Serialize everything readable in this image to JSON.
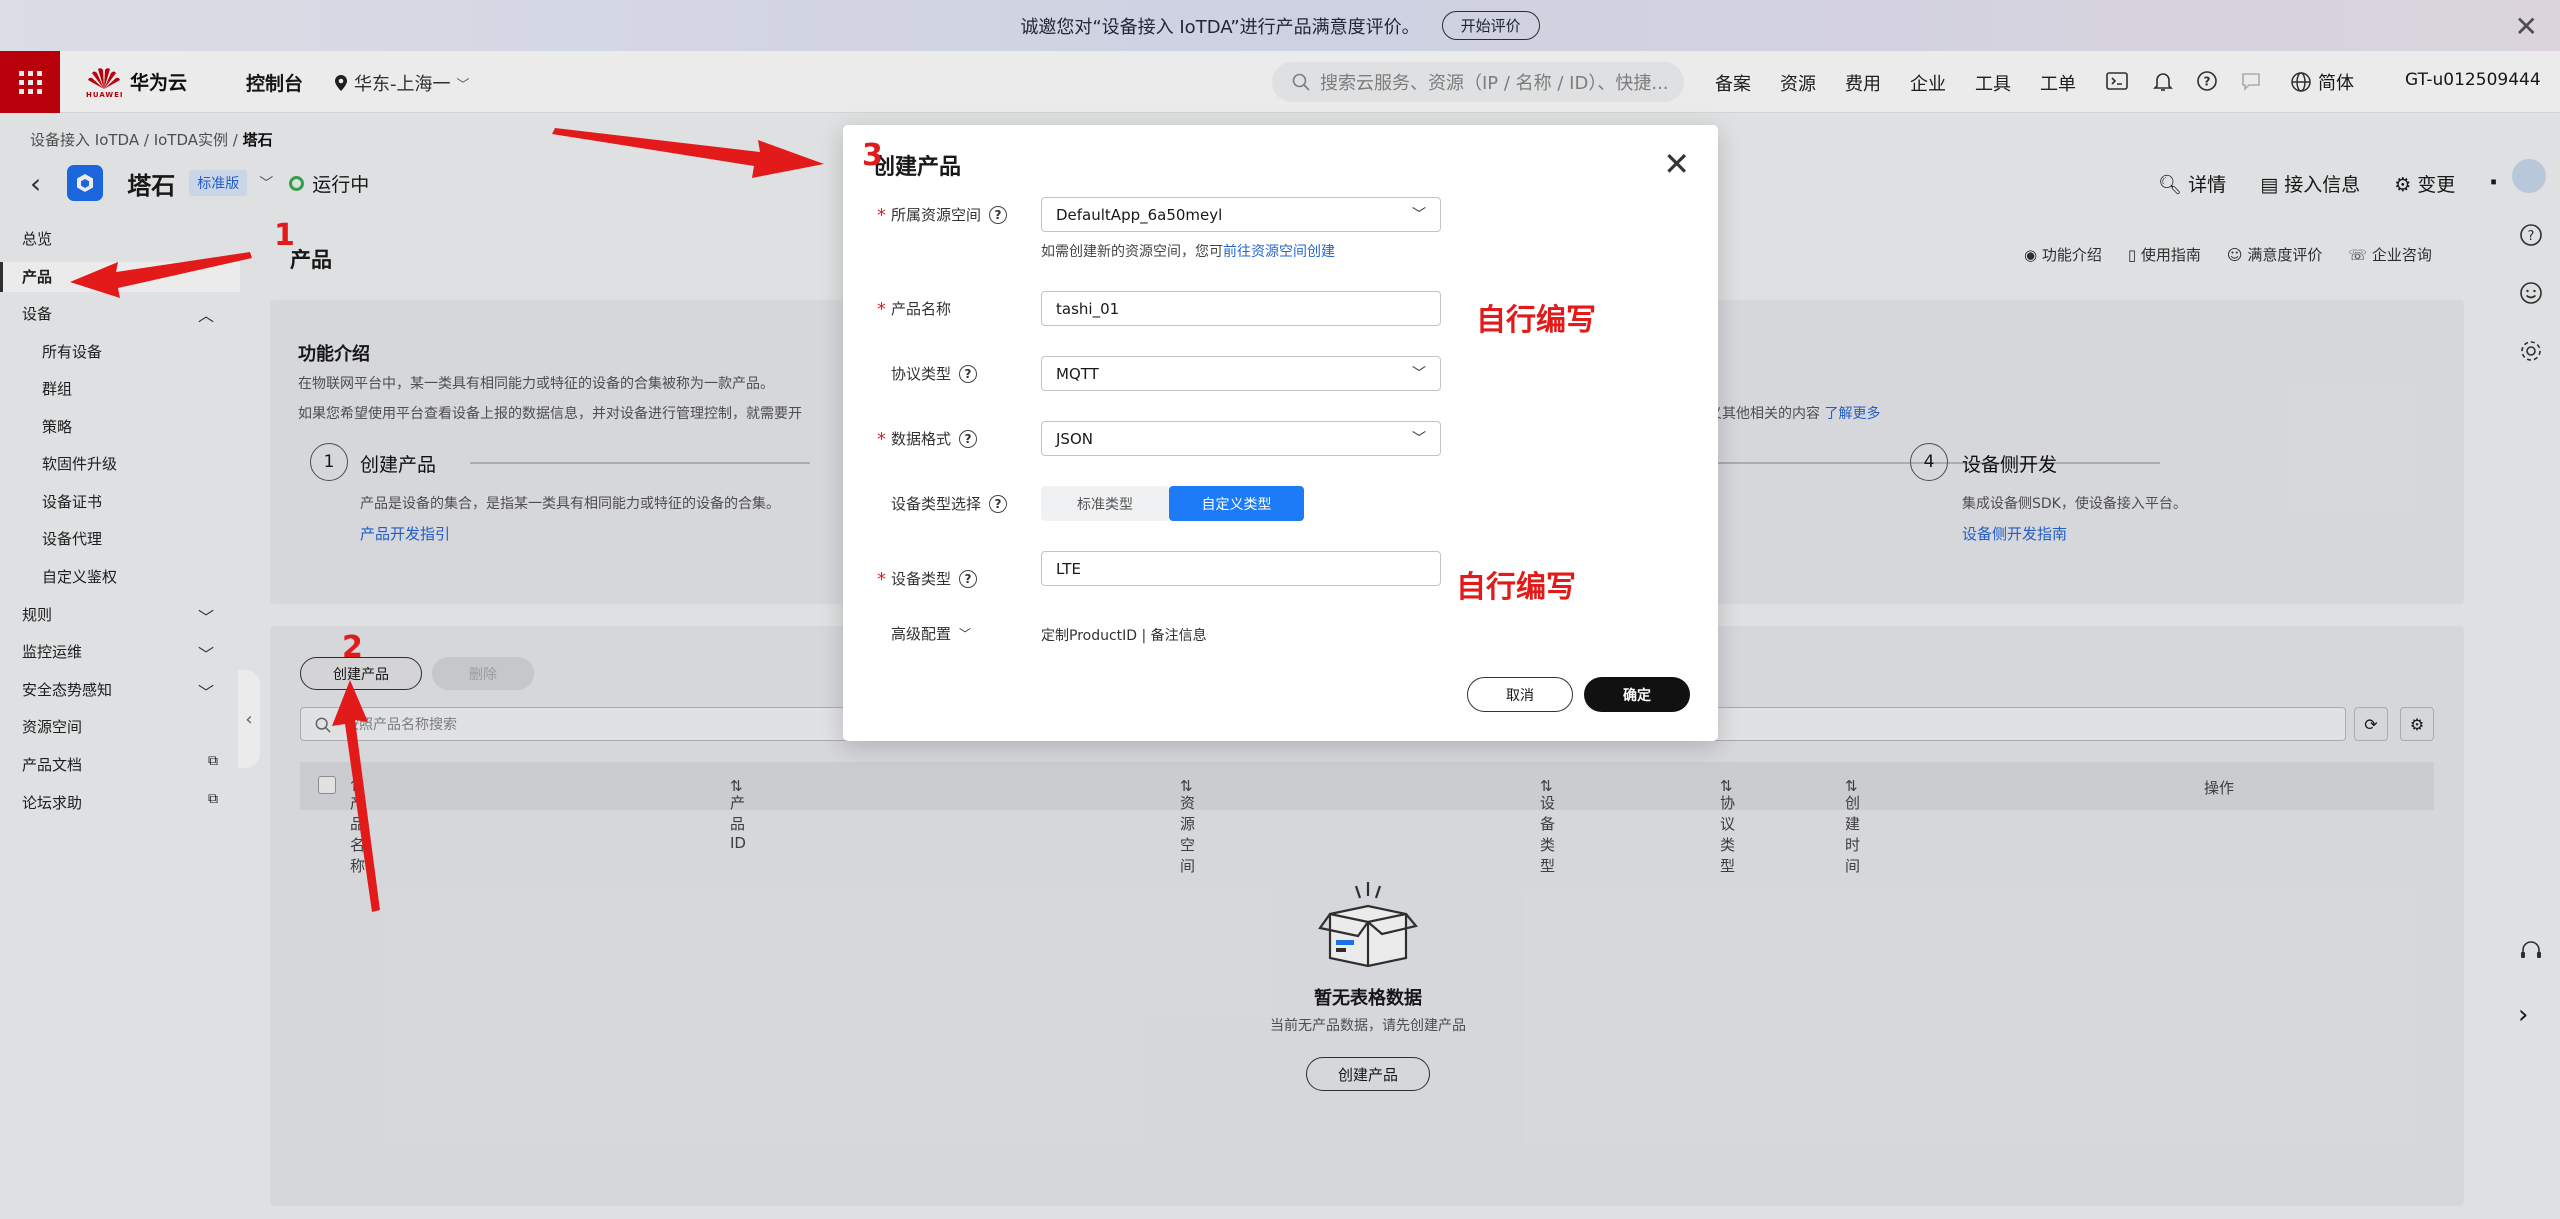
{
  "banner": {
    "text": "诚邀您对“设备接入 IoTDA”进行产品满意度评价。",
    "button": "开始评价"
  },
  "topbar": {
    "brand": "华为云",
    "brand_sub": "HUAWEI",
    "console": "控制台",
    "region": "华东-上海一",
    "search_placeholder": "搜索云服务、资源（IP / 名称 / ID）、快捷...",
    "nav": [
      "备案",
      "资源",
      "费用",
      "企业",
      "工具",
      "工单"
    ],
    "lang": "简体",
    "user": "GT-u012509444"
  },
  "breadcrumb": {
    "a": "设备接入 IoTDA",
    "b": "IoTDA实例",
    "c": "塔石"
  },
  "instance": {
    "name": "塔石",
    "badge": "标准版",
    "status": "运行中"
  },
  "right_actions": [
    "详情",
    "接入信息",
    "变更"
  ],
  "sidebar": {
    "overview": "总览",
    "product": "产品",
    "device": "设备",
    "device_subs": [
      "所有设备",
      "群组",
      "策略",
      "软固件升级",
      "设备证书",
      "设备代理",
      "自定义鉴权"
    ],
    "rules": "规则",
    "monitor": "监控运维",
    "security": "安全态势感知",
    "resource_space": "资源空间",
    "docs": "产品文档",
    "forum": "论坛求助"
  },
  "page": {
    "title": "产品",
    "links": [
      "功能介绍",
      "使用指南",
      "满意度评价",
      "企业咨询"
    ]
  },
  "intro": {
    "title": "功能介绍",
    "desc1": "在物联网平台中，某一类具有相同能力或特征的设备的合集被称为一款产品。",
    "desc2": "如果您希望使用平台查看设备上报的数据信息，并对设备进行管理控制，就需要开",
    "more_tail": "义其他相关的内容",
    "more_link": "了解更多",
    "step1": {
      "num": "1",
      "title": "创建产品",
      "desc": "产品是设备的集合，是指某一类具有相同能力或特征的设备的合集。",
      "link": "产品开发指引"
    },
    "step4": {
      "num": "4",
      "title": "设备侧开发",
      "desc": "集成设备侧SDK，使设备接入平台。",
      "link": "设备侧开发指南"
    }
  },
  "table": {
    "create": "创建产品",
    "delete": "删除",
    "search_placeholder": "按照产品名称搜索",
    "headers": [
      "产品名称",
      "产品ID",
      "资源空间",
      "设备类型",
      "协议类型",
      "创建时间",
      "操作"
    ],
    "empty_title": "暂无表格数据",
    "empty_desc": "当前无产品数据，请先创建产品",
    "empty_button": "创建产品"
  },
  "modal": {
    "title": "创建产品",
    "resource_space": {
      "label": "所属资源空间",
      "value": "DefaultApp_6a50meyl"
    },
    "hint": "如需创建新的资源空间，您可",
    "hint_link": "前往资源空间创建",
    "product_name": {
      "label": "产品名称",
      "value": "tashi_01"
    },
    "protocol": {
      "label": "协议类型",
      "value": "MQTT"
    },
    "data_format": {
      "label": "数据格式",
      "value": "JSON"
    },
    "device_type_select": {
      "label": "设备类型选择",
      "options": [
        "标准类型",
        "自定义类型"
      ],
      "selected": "自定义类型"
    },
    "device_type": {
      "label": "设备类型",
      "value": "LTE"
    },
    "advanced": {
      "label": "高级配置",
      "links": "定制ProductID | 备注信息"
    },
    "cancel": "取消",
    "ok": "确定"
  },
  "annotations": {
    "n1": "1",
    "n2": "2",
    "n3": "3",
    "note1": "自行编写",
    "note2": "自行编写"
  },
  "colors": {
    "brand_red": "#c7000b",
    "primary_blue": "#1e7bf7",
    "annotation_red": "#e21a1a",
    "status_green": "#3aad52"
  }
}
